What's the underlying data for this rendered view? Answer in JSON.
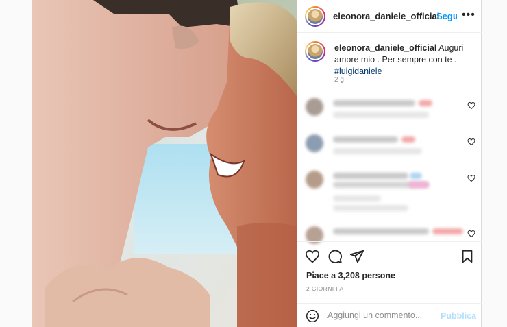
{
  "post": {
    "username": "eleonora_daniele_official",
    "follow_label": "Segui",
    "more_icon": "more-horizontal-icon"
  },
  "caption": {
    "username": "eleonora_daniele_official",
    "text": "Auguri amore mio . Per sempre con te .",
    "hashtag": "#luigidaniele",
    "age": "2 g"
  },
  "actions": {
    "like_icon": "heart-icon",
    "comment_icon": "comment-bubble-icon",
    "share_icon": "paper-plane-icon",
    "save_icon": "bookmark-icon"
  },
  "likes": {
    "text": "Piace a 3,208 persone"
  },
  "date": {
    "text": "2 GIORNI FA"
  },
  "add_comment": {
    "placeholder": "Aggiungi un commento...",
    "publish_label": "Pubblica"
  },
  "colors": {
    "accent": "#0095f6",
    "publish_disabled": "#b2dffc",
    "text": "#262626",
    "muted": "#8e8e8e"
  }
}
